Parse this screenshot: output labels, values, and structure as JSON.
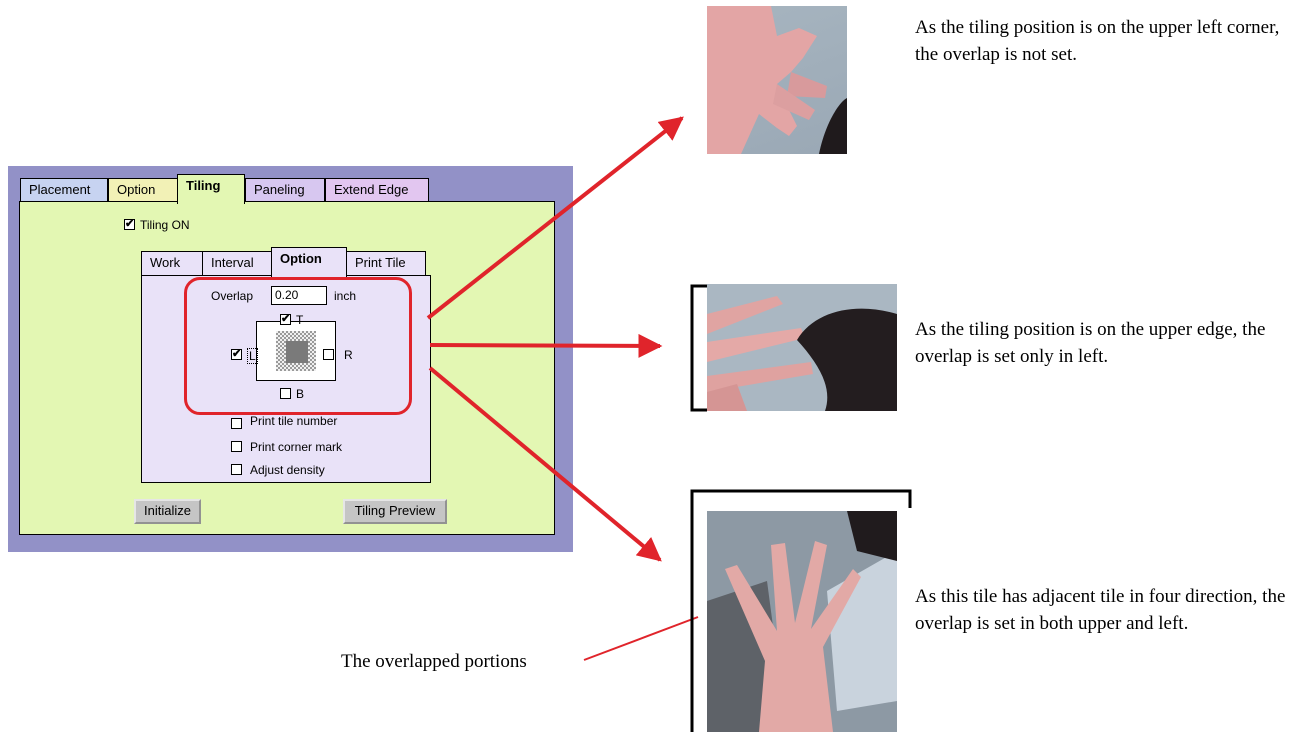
{
  "dialog": {
    "tabs": [
      "Placement",
      "Option",
      "Tiling",
      "Paneling",
      "Extend Edge"
    ],
    "tiling_on": {
      "label": "Tiling ON",
      "checked": true
    },
    "subtabs": [
      "Work",
      "Interval",
      "Option",
      "Print Tile"
    ],
    "overlap": {
      "label": "Overlap",
      "value": "0.20",
      "unit": "inch"
    },
    "sides": {
      "T": {
        "label": "T",
        "checked": true
      },
      "L": {
        "label": "L",
        "checked": true
      },
      "R": {
        "label": "R",
        "checked": false
      },
      "B": {
        "label": "B",
        "checked": false
      }
    },
    "options": [
      {
        "label": "Print tile number",
        "checked": false
      },
      {
        "label": "Print corner mark",
        "checked": false
      },
      {
        "label": "Adjust density",
        "checked": false
      }
    ],
    "buttons": {
      "initialize": "Initialize",
      "preview": "Tiling Preview"
    }
  },
  "annotations": {
    "top": "As the tiling position is on the upper left corner, the overlap is not set.",
    "middle": "As the tiling position is on the upper edge, the overlap is set only in left.",
    "bottom": "As this tile has adjacent tile in four direction, the overlap is set in both upper and left.",
    "overlapped_portions": "The overlapped portions"
  },
  "colors": {
    "arrow": "#e0242b",
    "dialog_frame": "#9291c7",
    "tiling_panel": "#e3f7b3",
    "option_panel": "#e9e2f8"
  }
}
